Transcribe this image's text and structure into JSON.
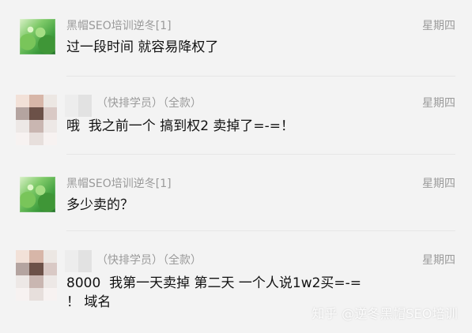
{
  "messages": [
    {
      "sender": "黑帽SEO培训逆冬[1]",
      "time": "星期四",
      "text_lines": [
        "过一段时间 就容易降权了"
      ]
    },
    {
      "sender": "（快排学员）（全款）",
      "time": "星期四",
      "text_lines": [
        "哦  我之前一个 搞到权2 卖掉了=-=！"
      ]
    },
    {
      "sender": "黑帽SEO培训逆冬[1]",
      "time": "星期四",
      "text_lines": [
        "多少卖的？"
      ]
    },
    {
      "sender": "（快排学员）（全款）",
      "time": "星期四",
      "text_lines": [
        "8000  我第一天卖掉 第二天 一个人说1w2买=-=",
        "！ 域名"
      ]
    }
  ],
  "watermark": "知乎 @逆冬黑帽SEO培训",
  "colors": {
    "background": "#f3f3f3",
    "meta_text": "#9a9a9a",
    "message_text": "#111111",
    "divider": "#e6e6e6"
  },
  "avatars": [
    "green-landscape-avatar",
    "pixelated-avatar",
    "green-landscape-avatar",
    "pixelated-avatar"
  ]
}
